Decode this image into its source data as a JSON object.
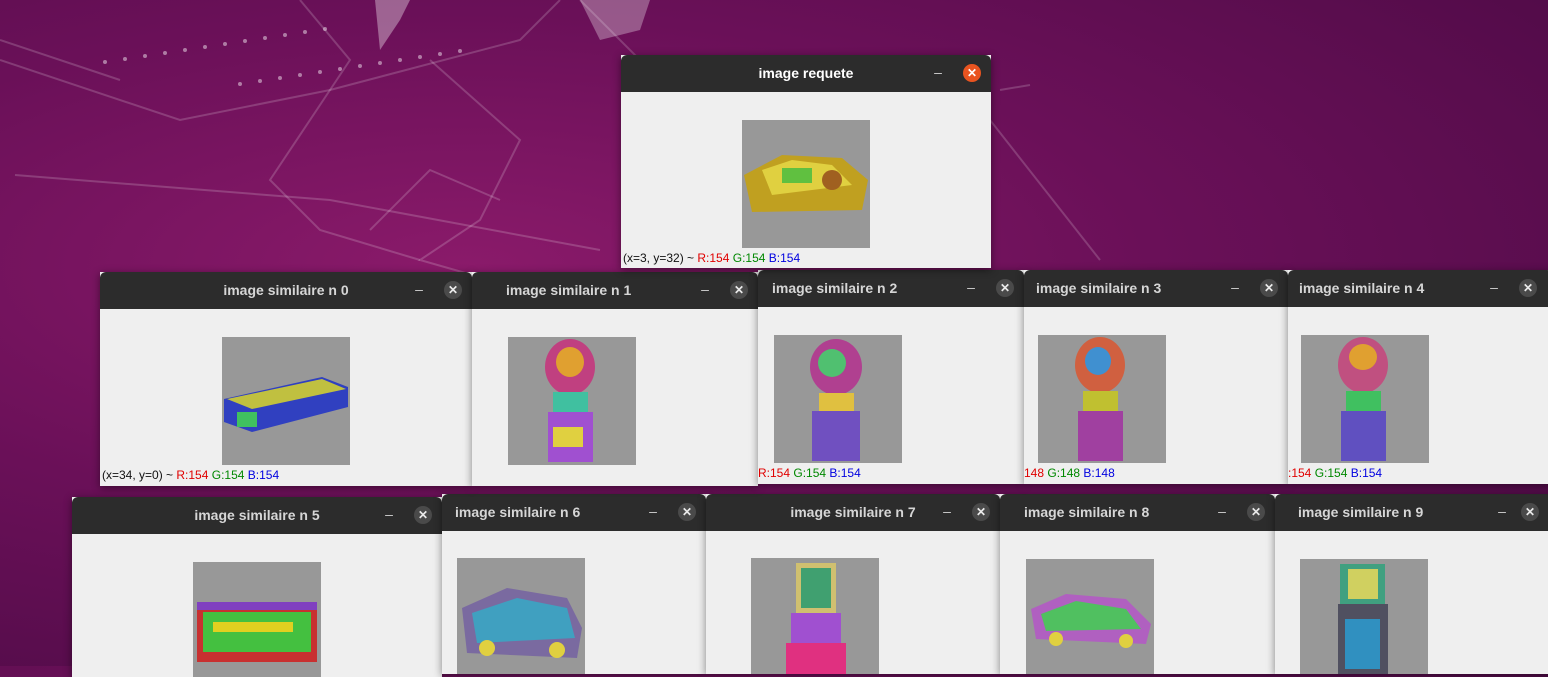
{
  "desktop": {
    "wallpaper": "ubuntu-focal-fossa-purple"
  },
  "colors": {
    "titlebar": "#2c2c2c",
    "close_active": "#e95420",
    "close_inactive": "#4a4a4a",
    "image_bg": "#989898"
  },
  "icons": {
    "minimize": "–",
    "close": "✕"
  },
  "windows": [
    {
      "title": "image requete",
      "status": {
        "coords": "(x=3, y=32) ~ ",
        "r": "R:154",
        "g": "G:154",
        "b": "B:154"
      }
    },
    {
      "title": "image similaire n 0",
      "status": {
        "coords": "(x=34, y=0) ~ ",
        "r": "R:154",
        "g": "G:154",
        "b": "B:154"
      }
    },
    {
      "title": "image similaire n 1"
    },
    {
      "title": "image similaire n 2",
      "status": {
        "coords": "",
        "r": "R:154",
        "g": "G:154",
        "b": "B:154"
      }
    },
    {
      "title": "image similaire n 3",
      "status": {
        "coords": "",
        "r": "148",
        "g": "G:148",
        "b": "B:148"
      }
    },
    {
      "title": "image similaire n 4",
      "status": {
        "coords": "",
        "r": ":154",
        "g": "G:154",
        "b": "B:154"
      }
    },
    {
      "title": "image similaire n 5"
    },
    {
      "title": "image similaire n 6"
    },
    {
      "title": "image similaire n 7"
    },
    {
      "title": "image similaire n 8"
    },
    {
      "title": "image similaire n 9"
    }
  ]
}
